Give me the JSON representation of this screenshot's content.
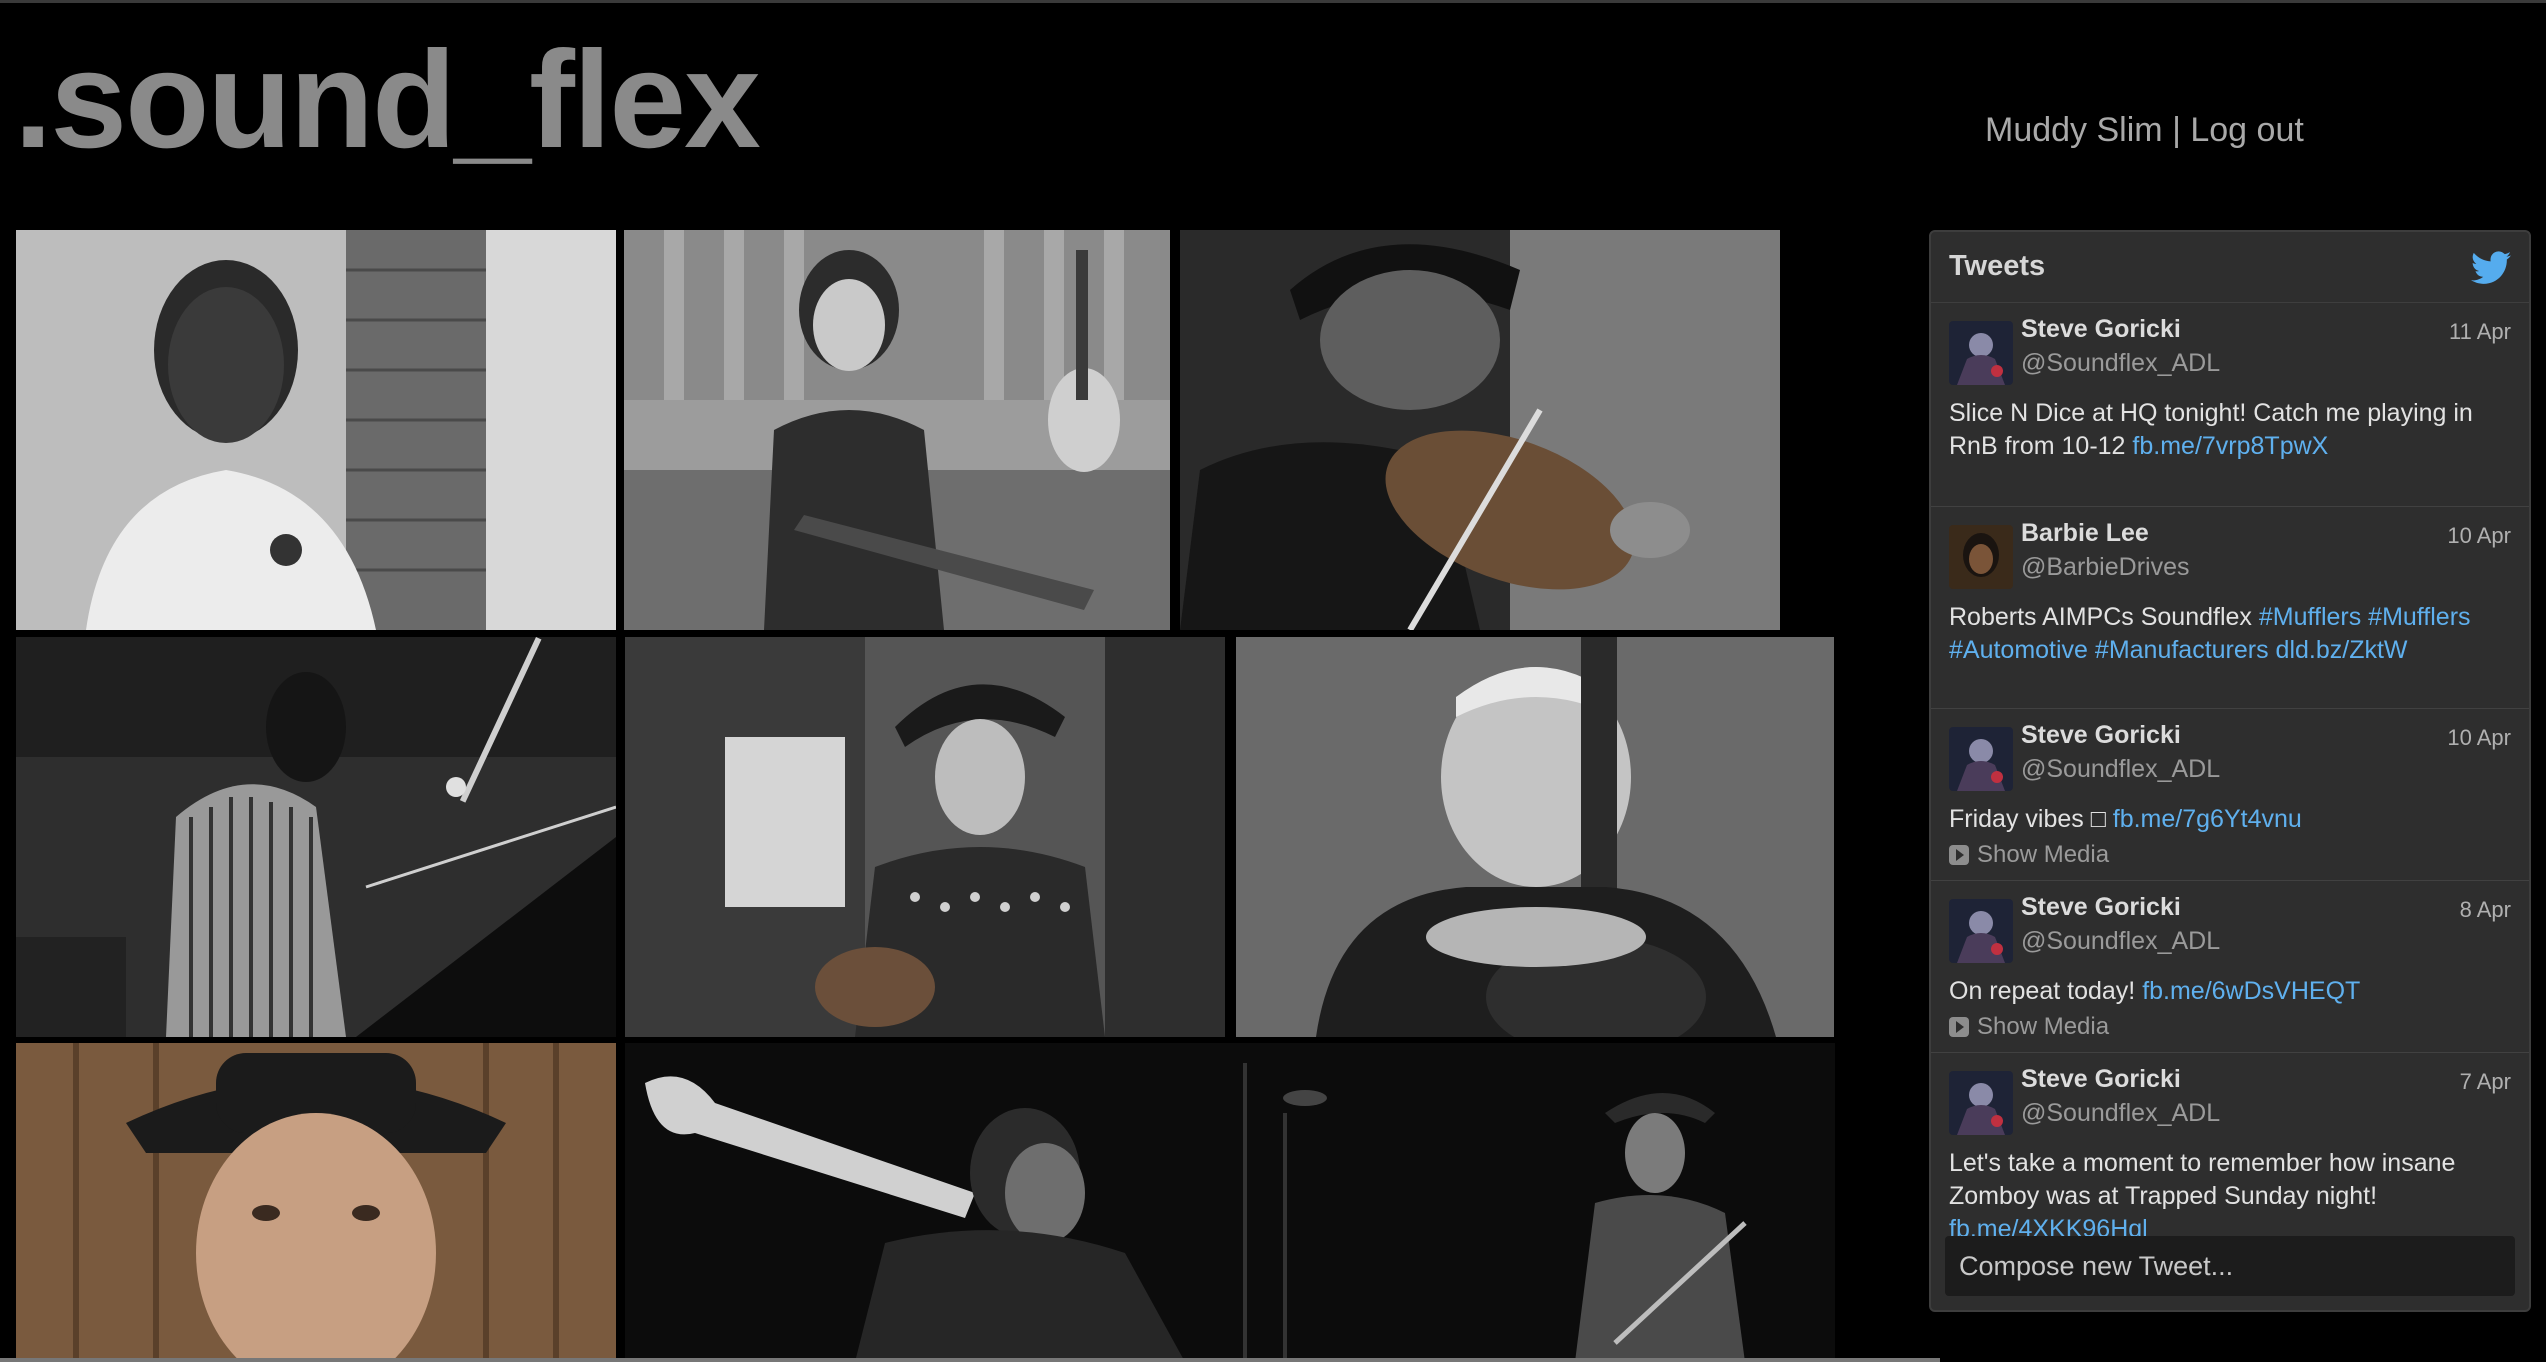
{
  "site": {
    "logo": ".sound_flex",
    "user": "Muddy Slim",
    "separator": "|",
    "logout": "Log out"
  },
  "gallery": {
    "photos": [
      {
        "subject": "man in white t-shirt by brick wall"
      },
      {
        "subject": "musician on couch with bass and acoustic guitar"
      },
      {
        "subject": "violinist in cap"
      },
      {
        "subject": "pianist in striped shirt"
      },
      {
        "subject": "guitarist in hat and sweater"
      },
      {
        "subject": "older man holding acoustic guitar"
      },
      {
        "subject": "man in fedora portrait"
      },
      {
        "subject": "trumpet player"
      },
      {
        "subject": "guitarist on stage with microphones"
      }
    ]
  },
  "tweets_panel": {
    "title": "Tweets",
    "compose_placeholder": "Compose new Tweet...",
    "items": [
      {
        "name": "Steve Goricki",
        "handle": "@Soundflex_ADL",
        "date": "11 Apr",
        "text": "Slice N Dice at HQ tonight! Catch me playing in RnB from 10-12 ",
        "link": "fb.me/7vrp8TpwX",
        "show_media": ""
      },
      {
        "name": "Barbie Lee",
        "handle": "@BarbieDrives",
        "date": "10 Apr",
        "text": "Roberts AIMPCs Soundflex ",
        "link": "#Mufflers #Mufflers #Automotive #Manufacturers dld.bz/ZktW",
        "show_media": ""
      },
      {
        "name": "Steve Goricki",
        "handle": "@Soundflex_ADL",
        "date": "10 Apr",
        "text": "Friday vibes □ ",
        "link": "fb.me/7g6Yt4vnu",
        "show_media": "Show Media"
      },
      {
        "name": "Steve Goricki",
        "handle": "@Soundflex_ADL",
        "date": "8 Apr",
        "text": "On repeat today! ",
        "link": "fb.me/6wDsVHEQT",
        "show_media": "Show Media"
      },
      {
        "name": "Steve Goricki",
        "handle": "@Soundflex_ADL",
        "date": "7 Apr",
        "text": "Let's take a moment to remember how insane Zomboy was at Trapped Sunday night! ",
        "link": "fb.me/4XKK96Hql",
        "show_media": ""
      }
    ]
  },
  "colors": {
    "background": "#000000",
    "logo": "#8a8a8a",
    "panel": "#2e2e2e",
    "link": "#5fb0ee",
    "twitter_bird": "#55acee"
  }
}
